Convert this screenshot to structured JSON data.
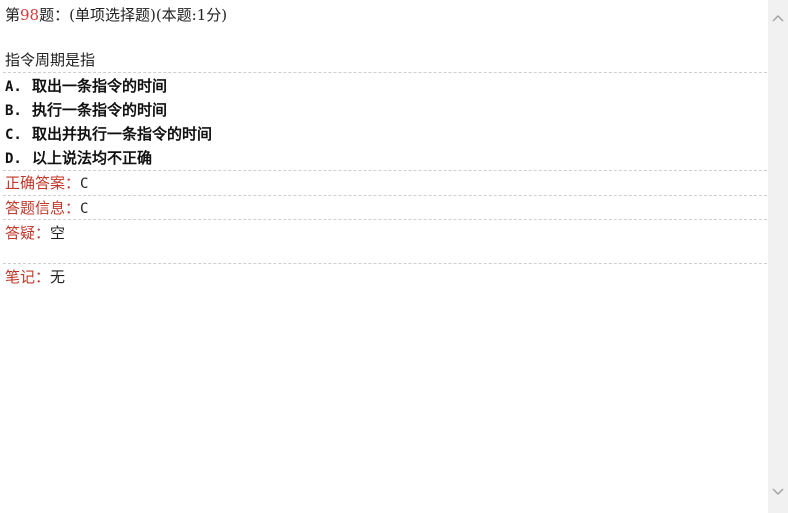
{
  "question": {
    "prefix": "第",
    "number": "98",
    "suffix": "题：(单项选择题)(本题:1分)",
    "stem": "指令周期是指"
  },
  "options": [
    {
      "letter": "A.",
      "text": "取出一条指令的时间"
    },
    {
      "letter": "B.",
      "text": "执行一条指令的时间"
    },
    {
      "letter": "C.",
      "text": "取出并执行一条指令的时间"
    },
    {
      "letter": "D.",
      "text": "以上说法均不正确"
    }
  ],
  "info": {
    "answer_label": "正确答案：",
    "answer_value": "C",
    "response_label": "答题信息：",
    "response_value": "C",
    "doubt_label": "答疑：",
    "doubt_value": "空",
    "note_label": "笔记：",
    "note_value": "无"
  },
  "colors": {
    "number": "#d03a3a",
    "label": "#c0392b",
    "divider": "#cfcfcf",
    "scrollbar": "#f1f1f1"
  },
  "icons": {
    "scroll_up": "chevron-up-icon",
    "scroll_down": "chevron-down-icon"
  }
}
